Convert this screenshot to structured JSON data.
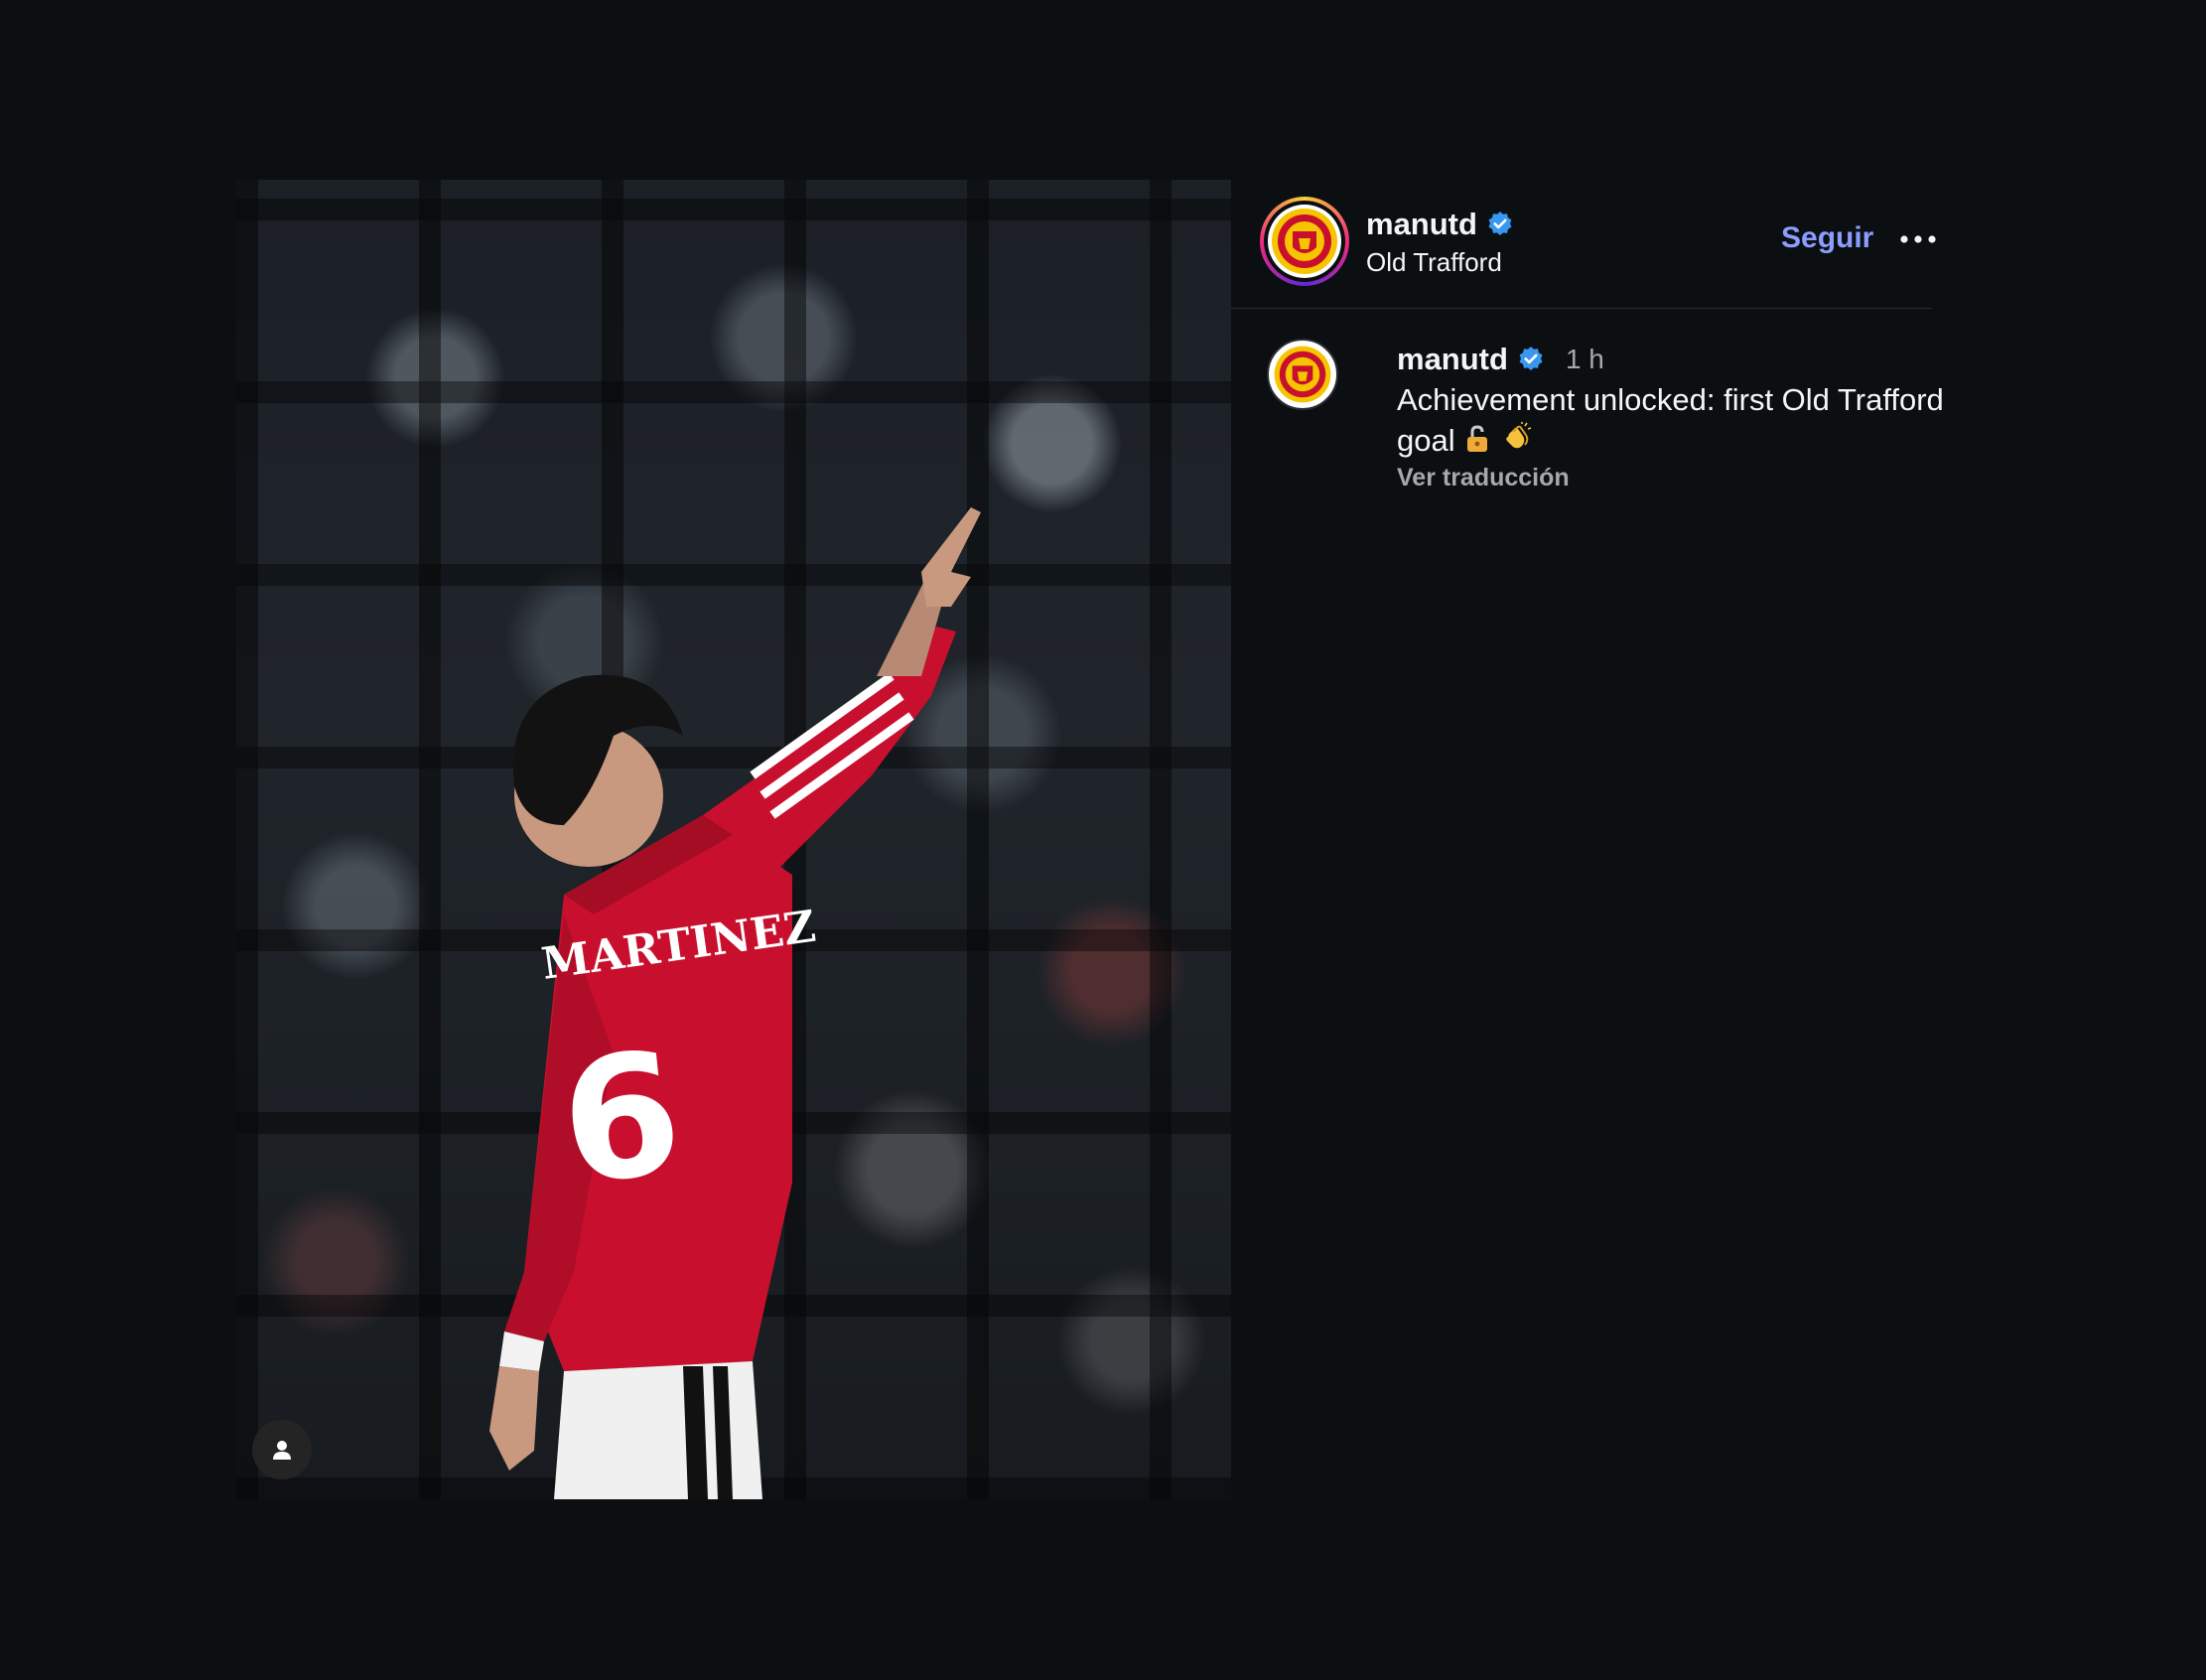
{
  "post": {
    "header": {
      "username": "manutd",
      "location": "Old Trafford",
      "follow_label": "Seguir",
      "more_icon": "more-horizontal-icon",
      "verified_icon": "verified-badge-icon"
    },
    "caption": {
      "username": "manutd",
      "time": "1 h",
      "text": "Achievement unlocked: first Old Trafford goal",
      "emojis": [
        "unlocked-padlock-emoji",
        "clapping-hands-emoji"
      ],
      "translate_label": "Ver traducción"
    },
    "media": {
      "jersey_name": "MARTINEZ",
      "jersey_number": "6",
      "tagged_users_icon": "person-icon"
    }
  },
  "colors": {
    "background": "#0b0f12",
    "follow_accent": "#8c9dff",
    "verified_blue": "#3897f0",
    "muted_text": "#a8a8a8",
    "kit_red": "#c8102e"
  }
}
